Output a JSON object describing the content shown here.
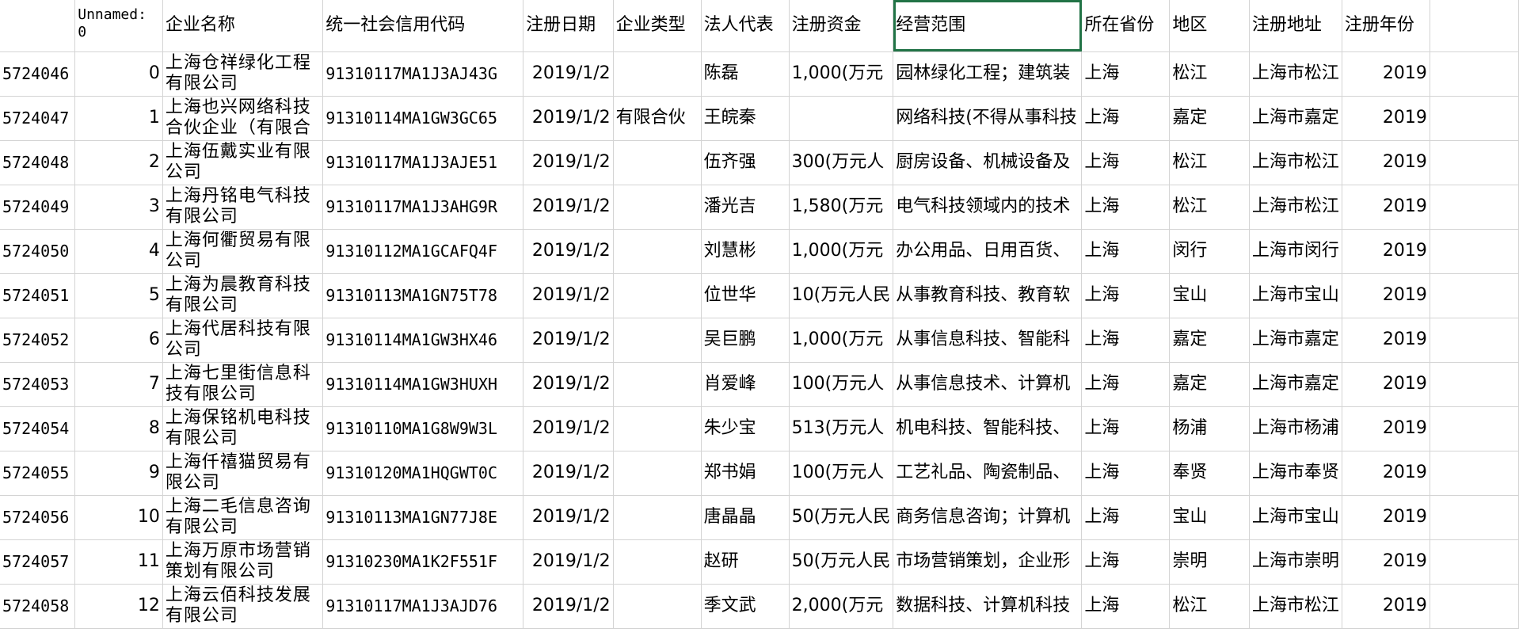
{
  "headers": [
    "",
    "Unnamed: 0",
    "企业名称",
    "统一社会信用代码",
    "注册日期",
    "企业类型",
    "法人代表",
    "注册资金",
    "经营范围",
    "所在省份",
    "地区",
    "注册地址",
    "注册年份"
  ],
  "rows": [
    [
      "5724046",
      "0",
      "上海仓祥绿化工程有限公司",
      "91310117MA1J3AJ43G",
      "2019/1/2",
      "",
      "陈磊",
      "1,000(万元",
      "园林绿化工程；建筑装",
      "上海",
      "松江",
      "上海市松江",
      "2019"
    ],
    [
      "5724047",
      "1",
      "上海也兴网络科技合伙企业（有限合伙）",
      "91310114MA1GW3GC65",
      "2019/1/2",
      "有限合伙",
      "王皖秦",
      "",
      "网络科技(不得从事科技",
      "上海",
      "嘉定",
      "上海市嘉定",
      "2019"
    ],
    [
      "5724048",
      "2",
      "上海伍戴实业有限公司",
      "91310117MA1J3AJE51",
      "2019/1/2",
      "",
      "伍齐强",
      "300(万元人",
      "厨房设备、机械设备及",
      "上海",
      "松江",
      "上海市松江",
      "2019"
    ],
    [
      "5724049",
      "3",
      "上海丹铭电气科技有限公司",
      "91310117MA1J3AHG9R",
      "2019/1/2",
      "",
      "潘光吉",
      "1,580(万元",
      "电气科技领域内的技术",
      "上海",
      "松江",
      "上海市松江",
      "2019"
    ],
    [
      "5724050",
      "4",
      "上海何衢贸易有限公司",
      "91310112MA1GCAFQ4F",
      "2019/1/2",
      "",
      "刘慧彬",
      "1,000(万元",
      "办公用品、日用百货、",
      "上海",
      "闵行",
      "上海市闵行",
      "2019"
    ],
    [
      "5724051",
      "5",
      "上海为晨教育科技有限公司",
      "91310113MA1GN75T78",
      "2019/1/2",
      "",
      "位世华",
      "10(万元人民",
      "从事教育科技、教育软",
      "上海",
      "宝山",
      "上海市宝山",
      "2019"
    ],
    [
      "5724052",
      "6",
      "上海代居科技有限公司",
      "91310114MA1GW3HX46",
      "2019/1/2",
      "",
      "吴巨鹏",
      "1,000(万元",
      "从事信息科技、智能科",
      "上海",
      "嘉定",
      "上海市嘉定",
      "2019"
    ],
    [
      "5724053",
      "7",
      "上海七里街信息科技有限公司",
      "91310114MA1GW3HUXH",
      "2019/1/2",
      "",
      "肖爱峰",
      "100(万元人",
      "从事信息技术、计算机",
      "上海",
      "嘉定",
      "上海市嘉定",
      "2019"
    ],
    [
      "5724054",
      "8",
      "上海保铭机电科技有限公司",
      "91310110MA1G8W9W3L",
      "2019/1/2",
      "",
      "朱少宝",
      "513(万元人",
      "机电科技、智能科技、",
      "上海",
      "杨浦",
      "上海市杨浦",
      "2019"
    ],
    [
      "5724055",
      "9",
      "上海仟禧猫贸易有限公司",
      "91310120MA1HQGWT0C",
      "2019/1/2",
      "",
      "郑书娟",
      "100(万元人",
      "工艺礼品、陶瓷制品、",
      "上海",
      "奉贤",
      "上海市奉贤",
      "2019"
    ],
    [
      "5724056",
      "10",
      "上海二毛信息咨询有限公司",
      "91310113MA1GN77J8E",
      "2019/1/2",
      "",
      "唐晶晶",
      "50(万元人民",
      "商务信息咨询；计算机",
      "上海",
      "宝山",
      "上海市宝山",
      "2019"
    ],
    [
      "5724057",
      "11",
      "上海万原市场营销策划有限公司",
      "91310230MA1K2F551F",
      "2019/1/2",
      "",
      "赵研",
      "50(万元人民",
      "市场营销策划，企业形",
      "上海",
      "崇明",
      "上海市崇明",
      "2019"
    ],
    [
      "5724058",
      "12",
      "上海云佰科技发展有限公司",
      "91310117MA1J3AJD76",
      "2019/1/2",
      "",
      "季文武",
      "2,000(万元",
      "数据科技、计算机科技",
      "上海",
      "松江",
      "上海市松江",
      "2019"
    ]
  ]
}
